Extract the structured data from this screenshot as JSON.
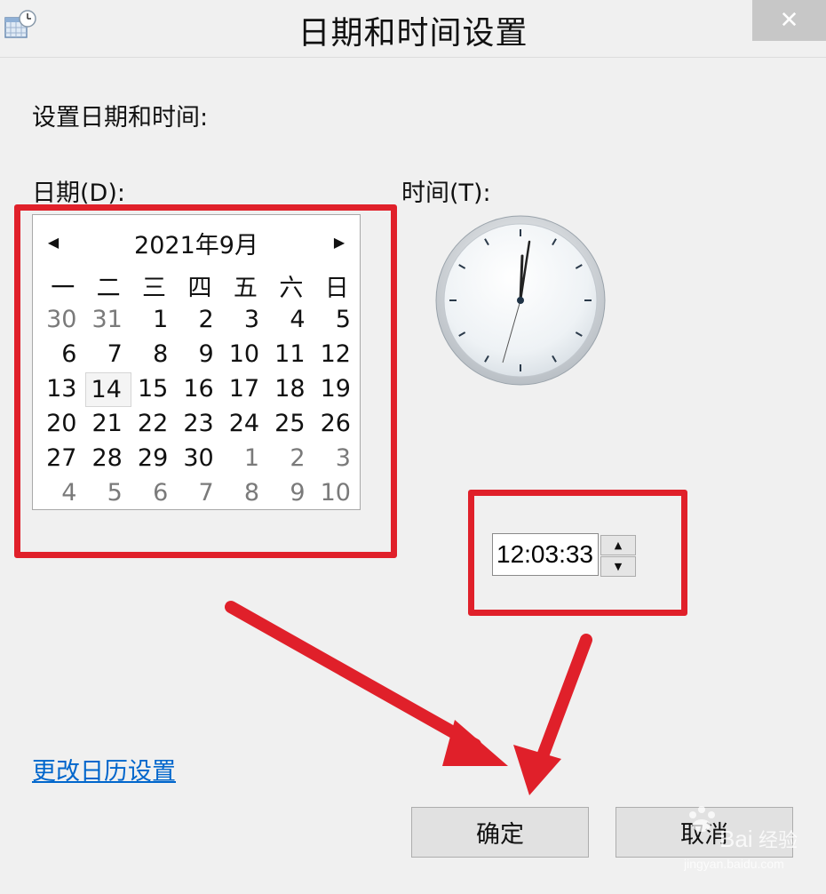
{
  "window": {
    "title": "日期和时间设置",
    "close_glyph": "✕",
    "app_icon": "calendar-clock-icon"
  },
  "heading": "设置日期和时间:",
  "date_label": "日期(D):",
  "time_label": "时间(T):",
  "calendar": {
    "month_title": "2021年9月",
    "prev_icon": "◀",
    "next_icon": "▶",
    "weekdays": [
      "一",
      "二",
      "三",
      "四",
      "五",
      "六",
      "日"
    ],
    "weeks": [
      [
        {
          "d": "30",
          "other": true
        },
        {
          "d": "31",
          "other": true
        },
        {
          "d": "1"
        },
        {
          "d": "2"
        },
        {
          "d": "3"
        },
        {
          "d": "4"
        },
        {
          "d": "5"
        }
      ],
      [
        {
          "d": "6"
        },
        {
          "d": "7"
        },
        {
          "d": "8"
        },
        {
          "d": "9"
        },
        {
          "d": "10"
        },
        {
          "d": "11"
        },
        {
          "d": "12"
        }
      ],
      [
        {
          "d": "13"
        },
        {
          "d": "14",
          "selected": true
        },
        {
          "d": "15"
        },
        {
          "d": "16"
        },
        {
          "d": "17"
        },
        {
          "d": "18"
        },
        {
          "d": "19"
        }
      ],
      [
        {
          "d": "20"
        },
        {
          "d": "21"
        },
        {
          "d": "22"
        },
        {
          "d": "23"
        },
        {
          "d": "24"
        },
        {
          "d": "25"
        },
        {
          "d": "26"
        }
      ],
      [
        {
          "d": "27"
        },
        {
          "d": "28"
        },
        {
          "d": "29"
        },
        {
          "d": "30"
        },
        {
          "d": "1",
          "other": true
        },
        {
          "d": "2",
          "other": true
        },
        {
          "d": "3",
          "other": true
        }
      ],
      [
        {
          "d": "4",
          "other": true
        },
        {
          "d": "5",
          "other": true
        },
        {
          "d": "6",
          "other": true
        },
        {
          "d": "7",
          "other": true
        },
        {
          "d": "8",
          "other": true
        },
        {
          "d": "9",
          "other": true
        },
        {
          "d": "10",
          "other": true
        }
      ]
    ]
  },
  "time": {
    "value": "12:03:33",
    "spin_up": "▲",
    "spin_down": "▼"
  },
  "calendar_settings_link": "更改日历设置",
  "buttons": {
    "ok": "确定",
    "cancel": "取消"
  },
  "watermark": {
    "text": "Bai 经验",
    "url_text": "jingyan.baidu.com"
  },
  "colors": {
    "highlight_red": "#e0202a",
    "link_blue": "#0066cc"
  }
}
